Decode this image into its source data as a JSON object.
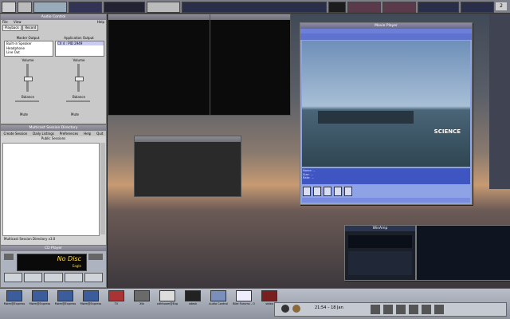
{
  "top_strip": {
    "badge": "2"
  },
  "audio_control": {
    "title": "Audio Control",
    "menu": [
      "File",
      "View",
      "Help"
    ],
    "tabs": [
      "Playback",
      "Record"
    ],
    "master_output_label": "Master Output",
    "application_output_label": "Application Output",
    "outputs": [
      "Built-in Speaker",
      "Headphone",
      "Line Out"
    ],
    "app_entry": "CX 4 : PID 2949",
    "volume_label": "Volume",
    "balance_label": "Balance",
    "mute_label": "Mute"
  },
  "multicast": {
    "title": "Multicast Session Directory",
    "menu": [
      "Create Session",
      "Daily Listings",
      "Preferences",
      "Help",
      "Quit"
    ],
    "section": "Public Sessions",
    "footer": "Multicast Session Directory v3.0"
  },
  "cd_player": {
    "title": "CD Player",
    "display_main": "No Disc",
    "display_sub": "Eagle"
  },
  "video": {
    "title": "Movie Player",
    "logo": "SCIENCE",
    "time_prefix": "Time:",
    "info_lines": [
      "Name: ...",
      "Size: ...",
      "Rate: ..."
    ]
  },
  "dock": {
    "clock": "21:54 – 18 Jan"
  },
  "taskbar": [
    {
      "label": "Mwm@Express"
    },
    {
      "label": "Mwm@Express"
    },
    {
      "label": "Mwm@Express"
    },
    {
      "label": "Mwm@Express"
    },
    {
      "label": "TV"
    },
    {
      "label": "Xtk"
    },
    {
      "label": "xdhhoom@Exp"
    },
    {
      "label": "xdesk"
    },
    {
      "label": "Audio Control"
    },
    {
      "label": "Bike Forums - O"
    },
    {
      "label": "video"
    }
  ],
  "player": {
    "title": "WinAmp"
  }
}
